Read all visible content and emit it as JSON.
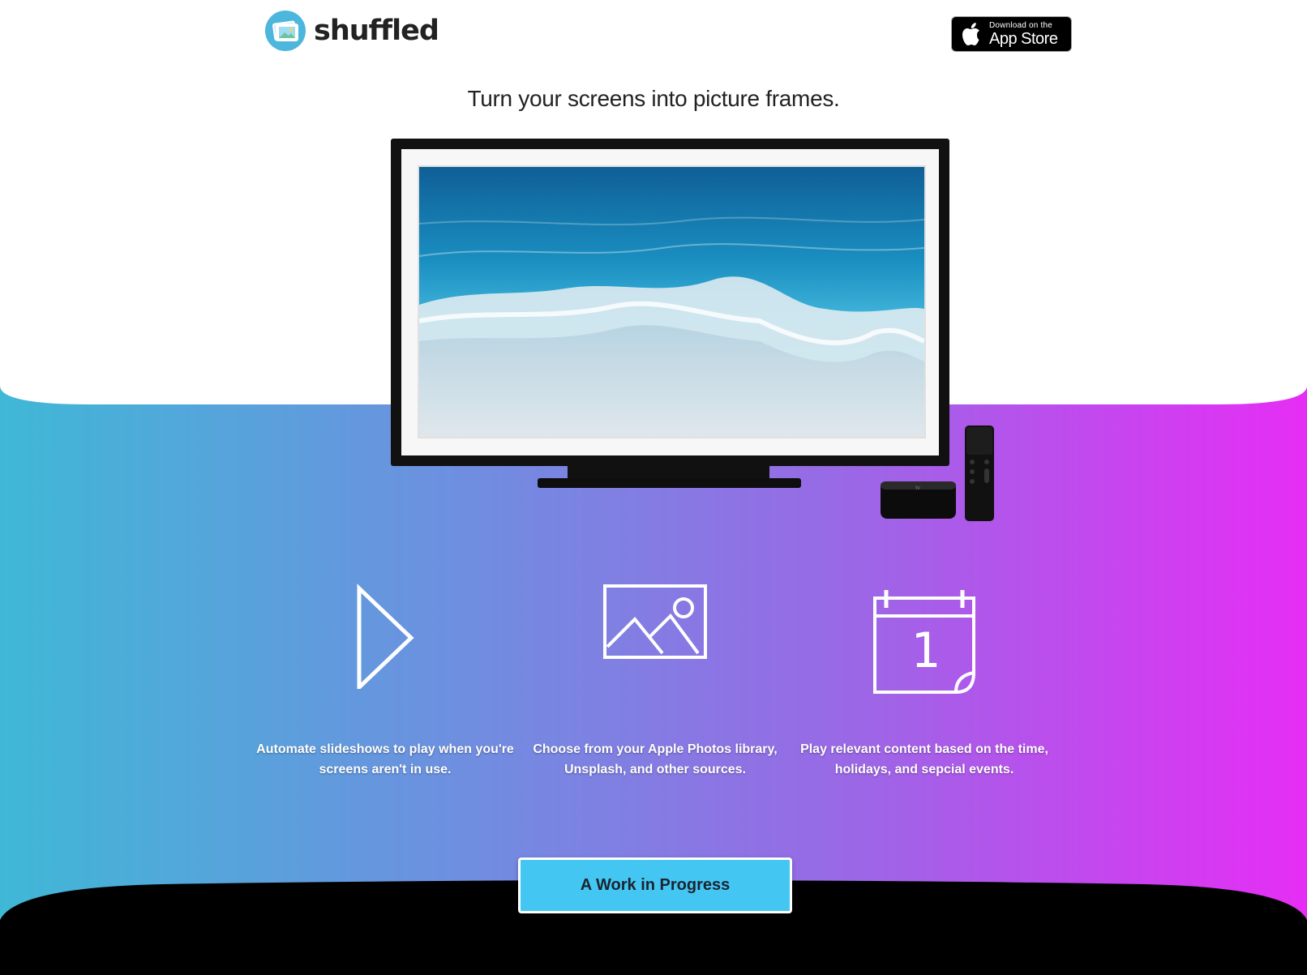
{
  "header": {
    "logo_text": "shuffled",
    "appstore_badge": {
      "small_label": "Download on the",
      "big_label": "App Store"
    }
  },
  "hero": {
    "tagline": "Turn your screens into picture frames."
  },
  "features": [
    {
      "icon": "play-icon",
      "text": "Automate slideshows to play when you're screens aren't in use."
    },
    {
      "icon": "image-icon",
      "text": "Choose from your Apple Photos library, Unsplash, and other sources."
    },
    {
      "icon": "calendar-icon",
      "text": "Play relevant content based on the time, holidays, and sepcial events."
    }
  ],
  "cta": {
    "label": "A Work in Progress"
  },
  "colors": {
    "gradient_start": "#3fb8d6",
    "gradient_end": "#e62df5",
    "cta_button": "#44c6f3",
    "logo_circle": "#4cb6dc"
  }
}
